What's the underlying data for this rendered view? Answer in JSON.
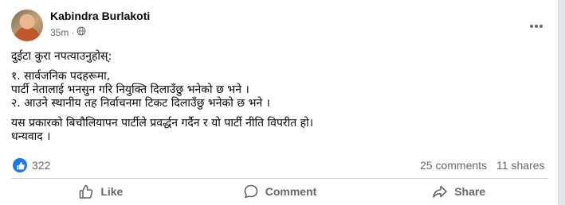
{
  "post": {
    "author": "Kabindra Burlakoti",
    "time": "35m",
    "separator": "·",
    "lines": [
      "दुईटा कुरा नपत्याउनुहोस्:",
      "१. सार्वजनिक पदहरूमा,",
      "पार्टी नेतालाई भनसुन गरि नियुक्ति दिलाउँछु भनेको छ भने ।",
      "२. आउने स्थानीय तह निर्वाचनमा टिकट दिलाउँछु भनेको छ भने ।",
      "यस प्रकारको बिचौलियापन पार्टीले प्रवर्द्धन गर्दैन र यो पार्टी नीति विपरीत हो।",
      "धन्यवाद ।"
    ]
  },
  "stats": {
    "reactions": "322",
    "comments": "25 comments",
    "shares": "11 shares"
  },
  "actions": {
    "like": "Like",
    "comment": "Comment",
    "share": "Share"
  },
  "colors": {
    "accent": "#1877f2",
    "muted": "#65676b",
    "text": "#050505"
  }
}
